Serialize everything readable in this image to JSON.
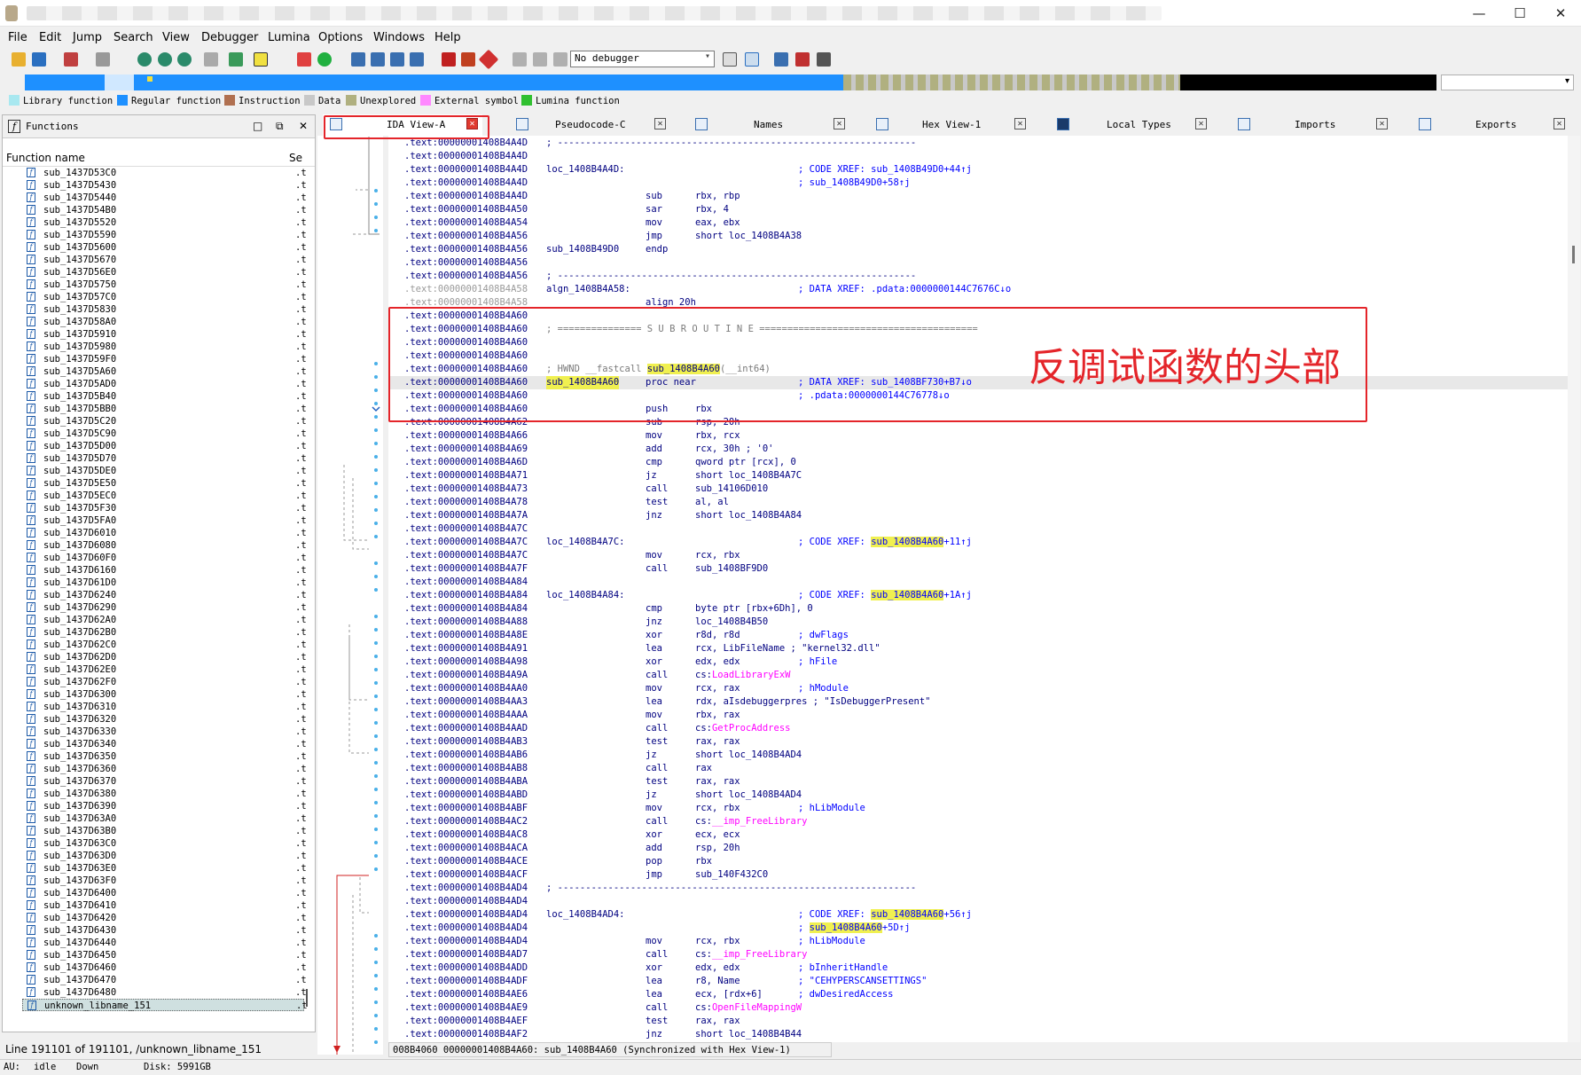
{
  "window": {
    "buttons": [
      "—",
      "☐",
      "✕"
    ]
  },
  "menu": [
    "File",
    "Edit",
    "Jump",
    "Search",
    "View",
    "Debugger",
    "Lumina",
    "Options",
    "Windows",
    "Help"
  ],
  "toolbar": {
    "debugger_select": "No debugger"
  },
  "legend": [
    {
      "label": "Library function",
      "color": "#a8e8f0"
    },
    {
      "label": "Regular function",
      "color": "#1e90ff"
    },
    {
      "label": "Instruction",
      "color": "#b07050"
    },
    {
      "label": "Data",
      "color": "#c8c8c8"
    },
    {
      "label": "Unexplored",
      "color": "#b0b080"
    },
    {
      "label": "External symbol",
      "color": "#ff88ff"
    },
    {
      "label": "Lumina function",
      "color": "#30c030"
    }
  ],
  "functions_panel": {
    "title": "Functions",
    "col_name": "Function name",
    "col_seg": "Se",
    "rows": [
      "sub_1437D53C0",
      "sub_1437D5430",
      "sub_1437D5440",
      "sub_1437D54B0",
      "sub_1437D5520",
      "sub_1437D5590",
      "sub_1437D5600",
      "sub_1437D5670",
      "sub_1437D56E0",
      "sub_1437D5750",
      "sub_1437D57C0",
      "sub_1437D5830",
      "sub_1437D58A0",
      "sub_1437D5910",
      "sub_1437D5980",
      "sub_1437D59F0",
      "sub_1437D5A60",
      "sub_1437D5AD0",
      "sub_1437D5B40",
      "sub_1437D5BB0",
      "sub_1437D5C20",
      "sub_1437D5C90",
      "sub_1437D5D00",
      "sub_1437D5D70",
      "sub_1437D5DE0",
      "sub_1437D5E50",
      "sub_1437D5EC0",
      "sub_1437D5F30",
      "sub_1437D5FA0",
      "sub_1437D6010",
      "sub_1437D6080",
      "sub_1437D60F0",
      "sub_1437D6160",
      "sub_1437D61D0",
      "sub_1437D6240",
      "sub_1437D6290",
      "sub_1437D62A0",
      "sub_1437D62B0",
      "sub_1437D62C0",
      "sub_1437D62D0",
      "sub_1437D62E0",
      "sub_1437D62F0",
      "sub_1437D6300",
      "sub_1437D6310",
      "sub_1437D6320",
      "sub_1437D6330",
      "sub_1437D6340",
      "sub_1437D6350",
      "sub_1437D6360",
      "sub_1437D6370",
      "sub_1437D6380",
      "sub_1437D6390",
      "sub_1437D63A0",
      "sub_1437D63B0",
      "sub_1437D63C0",
      "sub_1437D63D0",
      "sub_1437D63E0",
      "sub_1437D63F0",
      "sub_1437D6400",
      "sub_1437D6410",
      "sub_1437D6420",
      "sub_1437D6430",
      "sub_1437D6440",
      "sub_1437D6450",
      "sub_1437D6460",
      "sub_1437D6470",
      "sub_1437D6480",
      "unknown_libname_151"
    ],
    "seg": ".t",
    "status": "Line 191101 of 191101, /unknown_libname_151"
  },
  "tabs": [
    {
      "label": "IDA View-A",
      "active": true
    },
    {
      "label": "Pseudocode-C"
    },
    {
      "label": "Names"
    },
    {
      "label": "Hex View-1"
    },
    {
      "label": "Local Types"
    },
    {
      "label": "Imports"
    },
    {
      "label": "Exports"
    }
  ],
  "annotation": "反调试函数的头部",
  "disasm_status": "008B4060 00000001408B4A60: sub_1408B4A60 (Synchronized with Hex View-1)",
  "statusbar": {
    "au": "AU:",
    "state": "idle",
    "dir": "Down",
    "disk": "Disk: 5991GB"
  }
}
